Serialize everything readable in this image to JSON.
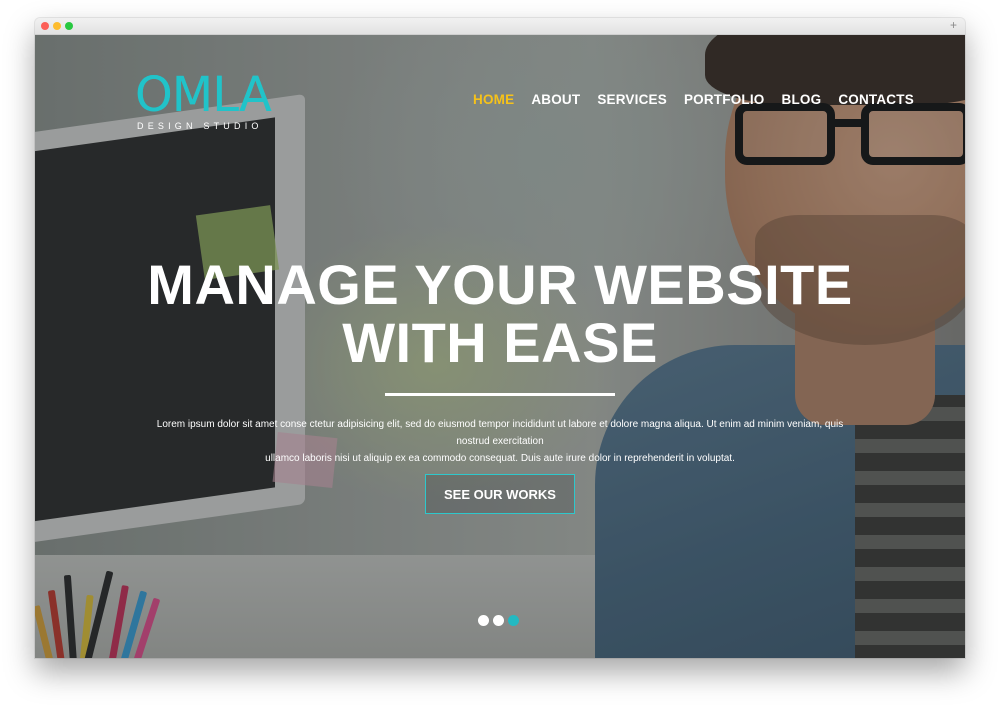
{
  "browser": {
    "newtab_icon": "plus-icon"
  },
  "logo": {
    "main": "OMLA",
    "sub": "DESIGN STUDIO",
    "color": "#21c3c9"
  },
  "nav": {
    "items": [
      {
        "label": "HOME",
        "active": true
      },
      {
        "label": "ABOUT"
      },
      {
        "label": "SERVICES"
      },
      {
        "label": "PORTFOLIO"
      },
      {
        "label": "BLOG"
      },
      {
        "label": "CONTACTS"
      }
    ],
    "active_color": "#f6c21a"
  },
  "hero": {
    "headline_line1": "MANAGE YOUR WEBSITE",
    "headline_line2": "WITH EASE",
    "lead_line1": "Lorem ipsum dolor sit amet conse ctetur adipisicing elit, sed do eiusmod tempor incididunt ut labore et dolore magna aliqua. Ut enim ad minim veniam, quis nostrud exercitation",
    "lead_line2": "ullamco laboris nisi ut aliquip ex ea commodo consequat. Duis aute irure dolor in reprehenderit in voluptat.",
    "cta_label": "SEE OUR WORKS",
    "accent_color": "#2ec8cc"
  },
  "slider": {
    "count": 3,
    "active_index": 3
  }
}
